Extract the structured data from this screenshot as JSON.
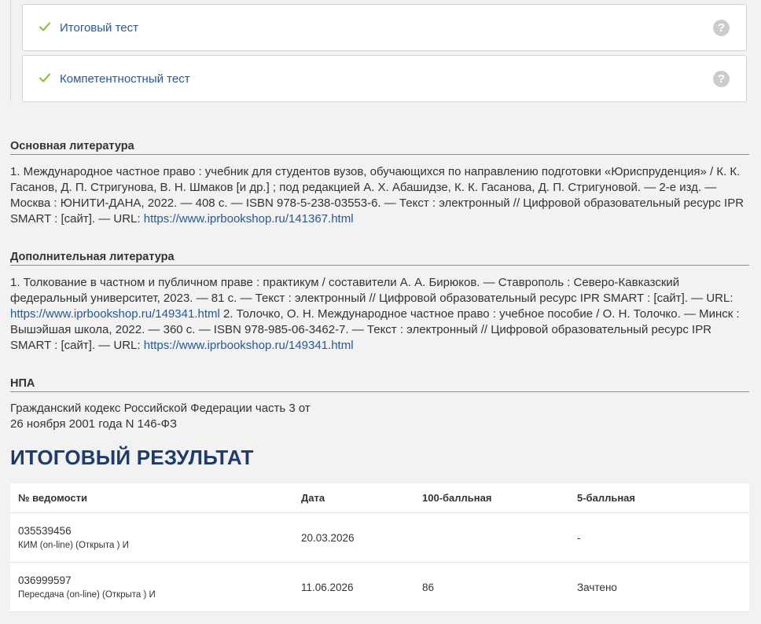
{
  "tests": [
    {
      "label": "Итоговый тест",
      "status_icon": "check-icon",
      "help_icon": "?"
    },
    {
      "label": "Компетентностный тест",
      "status_icon": "check-icon",
      "help_icon": "?"
    }
  ],
  "main_lit": {
    "heading": "Основная литература",
    "text": "1. Международное частное право : учебник для студентов вузов, обучающихся по направлению подготовки «Юриспруденция» / К. К. Гасанов, Д. П. Стригунова, В. Н. Шмаков [и др.] ; под редакцией А. Х. Абашидзе, К. К. Гасанова, Д. П. Стригуновой. — 2-е изд. — Москва : ЮНИТИ-ДАНА, 2022. — 408 с. — ISBN 978-5-238-03553-6. — Текст : электронный // Цифровой образовательный ресурс IPR SMART : [сайт]. — URL: ",
    "link": "https://www.iprbookshop.ru/141367.html"
  },
  "add_lit": {
    "heading": "Дополнительная литература",
    "text1": "1. Толкование в частном и публичном праве : практикум / составители А. А. Бирюков. — Ставрополь : Северо-Кавказский федеральный университет, 2023. — 81 с. — Текст : электронный // Цифровой образовательный ресурс IPR SMART : [сайт]. — URL: ",
    "link1": "https://www.iprbookshop.ru/149341.html",
    "text2": " 2. Толочко, О. Н. Международное частное право : учебное пособие / О. Н. Толочко. — Минск : Вышэйшая школа, 2022. — 360 с. — ISBN 978-985-06-3462-7. — Текст : электронный // Цифровой образовательный ресурс IPR SMART : [сайт]. — URL: ",
    "link2": "https://www.iprbookshop.ru/149341.html"
  },
  "npa": {
    "heading": "НПА",
    "line1": "Гражданский кодекс Российской Федерации часть 3 от",
    "line2": "26 ноября 2001 года N 146-ФЗ"
  },
  "result": {
    "title": "ИТОГОВЫЙ РЕЗУЛЬТАТ",
    "headers": [
      "№ ведомости",
      "Дата",
      "100-балльная",
      "5-балльная"
    ],
    "rows": [
      {
        "number": "035539456",
        "type": "КИМ (on-line) (Открыта ) И",
        "date": "20.03.2026",
        "score100": "",
        "score5": "-"
      },
      {
        "number": "036999597",
        "type": "Пересдача (on-line) (Открыта ) И",
        "date": "11.06.2026",
        "score100": "86",
        "score5": "Зачтено"
      }
    ]
  },
  "colors": {
    "link": "#27589a",
    "check": "#8bc34a",
    "title": "#1f3b6b",
    "background": "#f2f2f2"
  }
}
